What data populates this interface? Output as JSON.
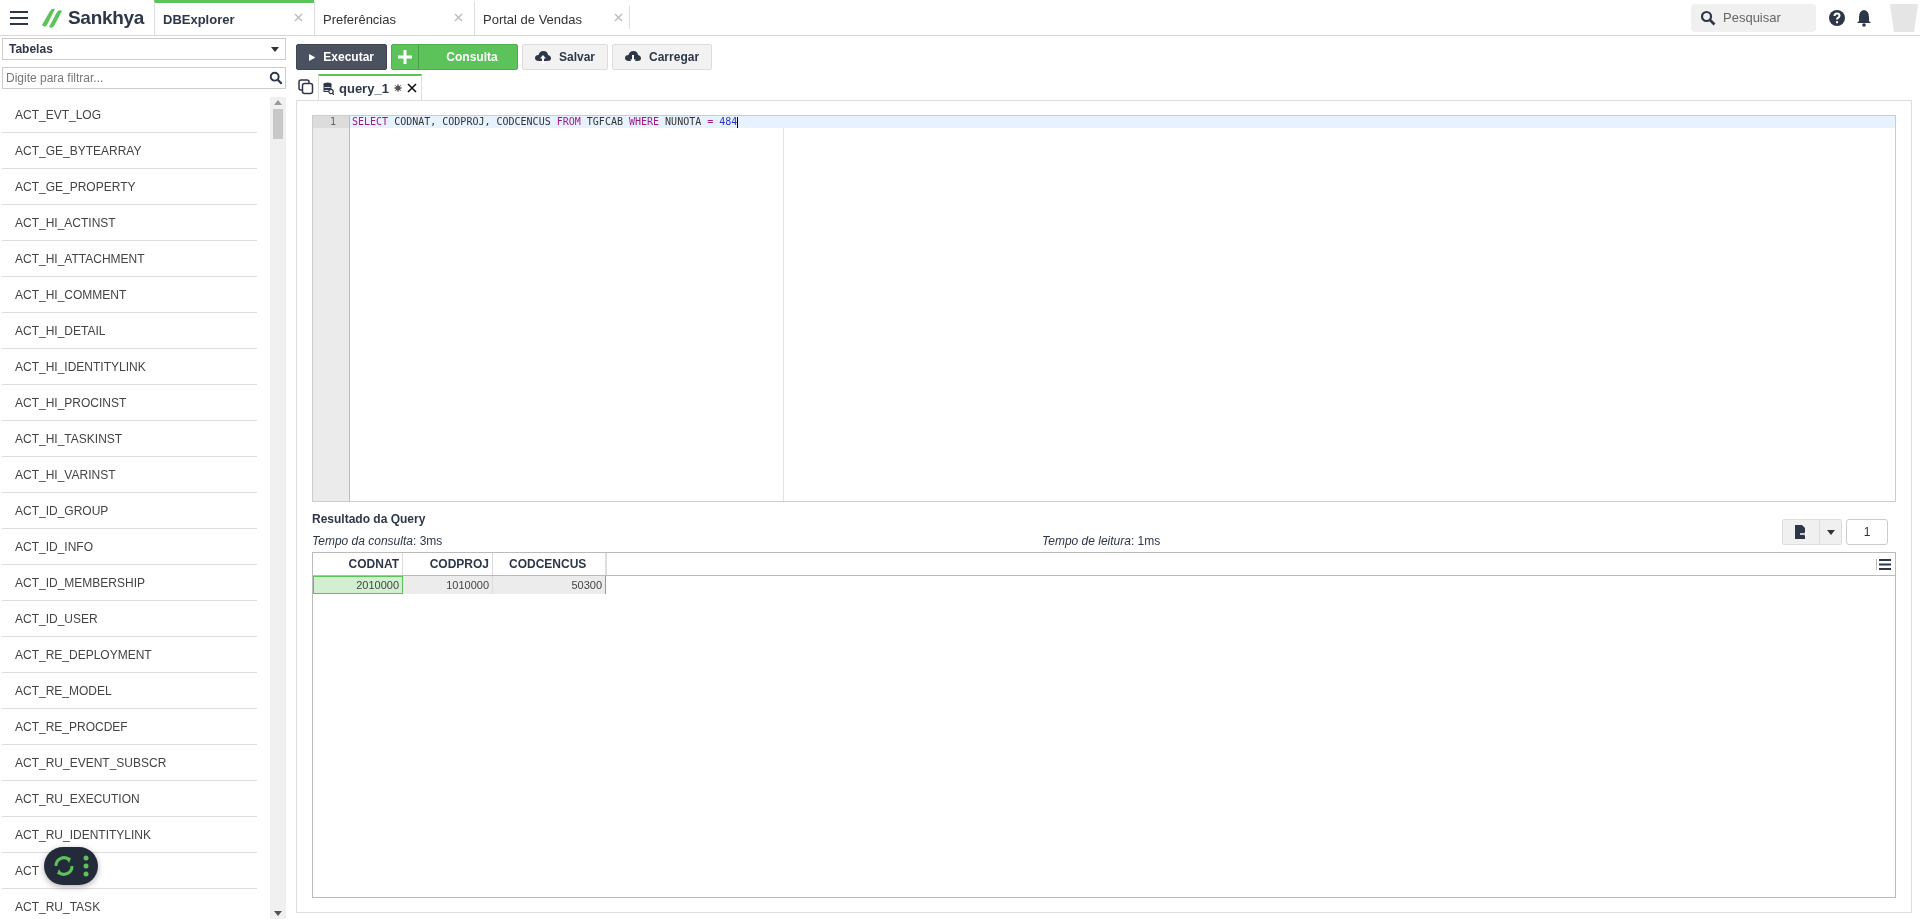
{
  "app_bar": {
    "brand": "Sankhya",
    "tabs": [
      {
        "label": "DBExplorer",
        "selected": true
      },
      {
        "label": "Preferências",
        "selected": false
      },
      {
        "label": "Portal de Vendas",
        "selected": false
      }
    ],
    "search": {
      "placeholder": "Pesquisar"
    }
  },
  "sidebar": {
    "object_type": "Tabelas",
    "filter": {
      "placeholder": "Digite para filtrar..."
    },
    "items": [
      "ACT_EVT_LOG",
      "ACT_GE_BYTEARRAY",
      "ACT_GE_PROPERTY",
      "ACT_HI_ACTINST",
      "ACT_HI_ATTACHMENT",
      "ACT_HI_COMMENT",
      "ACT_HI_DETAIL",
      "ACT_HI_IDENTITYLINK",
      "ACT_HI_PROCINST",
      "ACT_HI_TASKINST",
      "ACT_HI_VARINST",
      "ACT_ID_GROUP",
      "ACT_ID_INFO",
      "ACT_ID_MEMBERSHIP",
      "ACT_ID_USER",
      "ACT_RE_DEPLOYMENT",
      "ACT_RE_MODEL",
      "ACT_RE_PROCDEF",
      "ACT_RU_EVENT_SUBSCR",
      "ACT_RU_EXECUTION",
      "ACT_RU_IDENTITYLINK",
      "ACT",
      "ACT_RU_TASK"
    ]
  },
  "toolbar": {
    "buttons": [
      {
        "kind": "run",
        "label": "Executar"
      },
      {
        "kind": "new",
        "label": "Consulta"
      },
      {
        "kind": "save",
        "label": "Salvar"
      },
      {
        "kind": "load",
        "label": "Carregar"
      }
    ]
  },
  "query_tabs": [
    {
      "label": "query_1",
      "selected": true,
      "modified": true
    }
  ],
  "editor": {
    "lines": [
      {
        "number": "1",
        "tokens": [
          {
            "kind": "keyword",
            "text": "SELECT"
          },
          {
            "kind": "plain",
            "text": " CODNAT, CODPROJ, CODCENCUS "
          },
          {
            "kind": "keyword",
            "text": "FROM"
          },
          {
            "kind": "plain",
            "text": " TGFCAB "
          },
          {
            "kind": "keyword",
            "text": "WHERE"
          },
          {
            "kind": "plain",
            "text": " NUNOTA "
          },
          {
            "kind": "operator",
            "text": "="
          },
          {
            "kind": "number",
            "text": " 484"
          }
        ]
      }
    ]
  },
  "results": {
    "title": "Resultado da Query",
    "query_time": "*Tempo da consulta*: 3ms",
    "read_time": "*Tempo de leitura*: 1ms",
    "page": "1",
    "columns": [
      "CODNAT",
      "CODPROJ",
      "CODCENCUS"
    ],
    "rows": [
      {
        "cells": [
          {
            "text": "2010000",
            "selected": true
          },
          {
            "text": "1010000",
            "selected": false
          },
          {
            "text": "50300",
            "selected": false
          }
        ]
      }
    ]
  }
}
